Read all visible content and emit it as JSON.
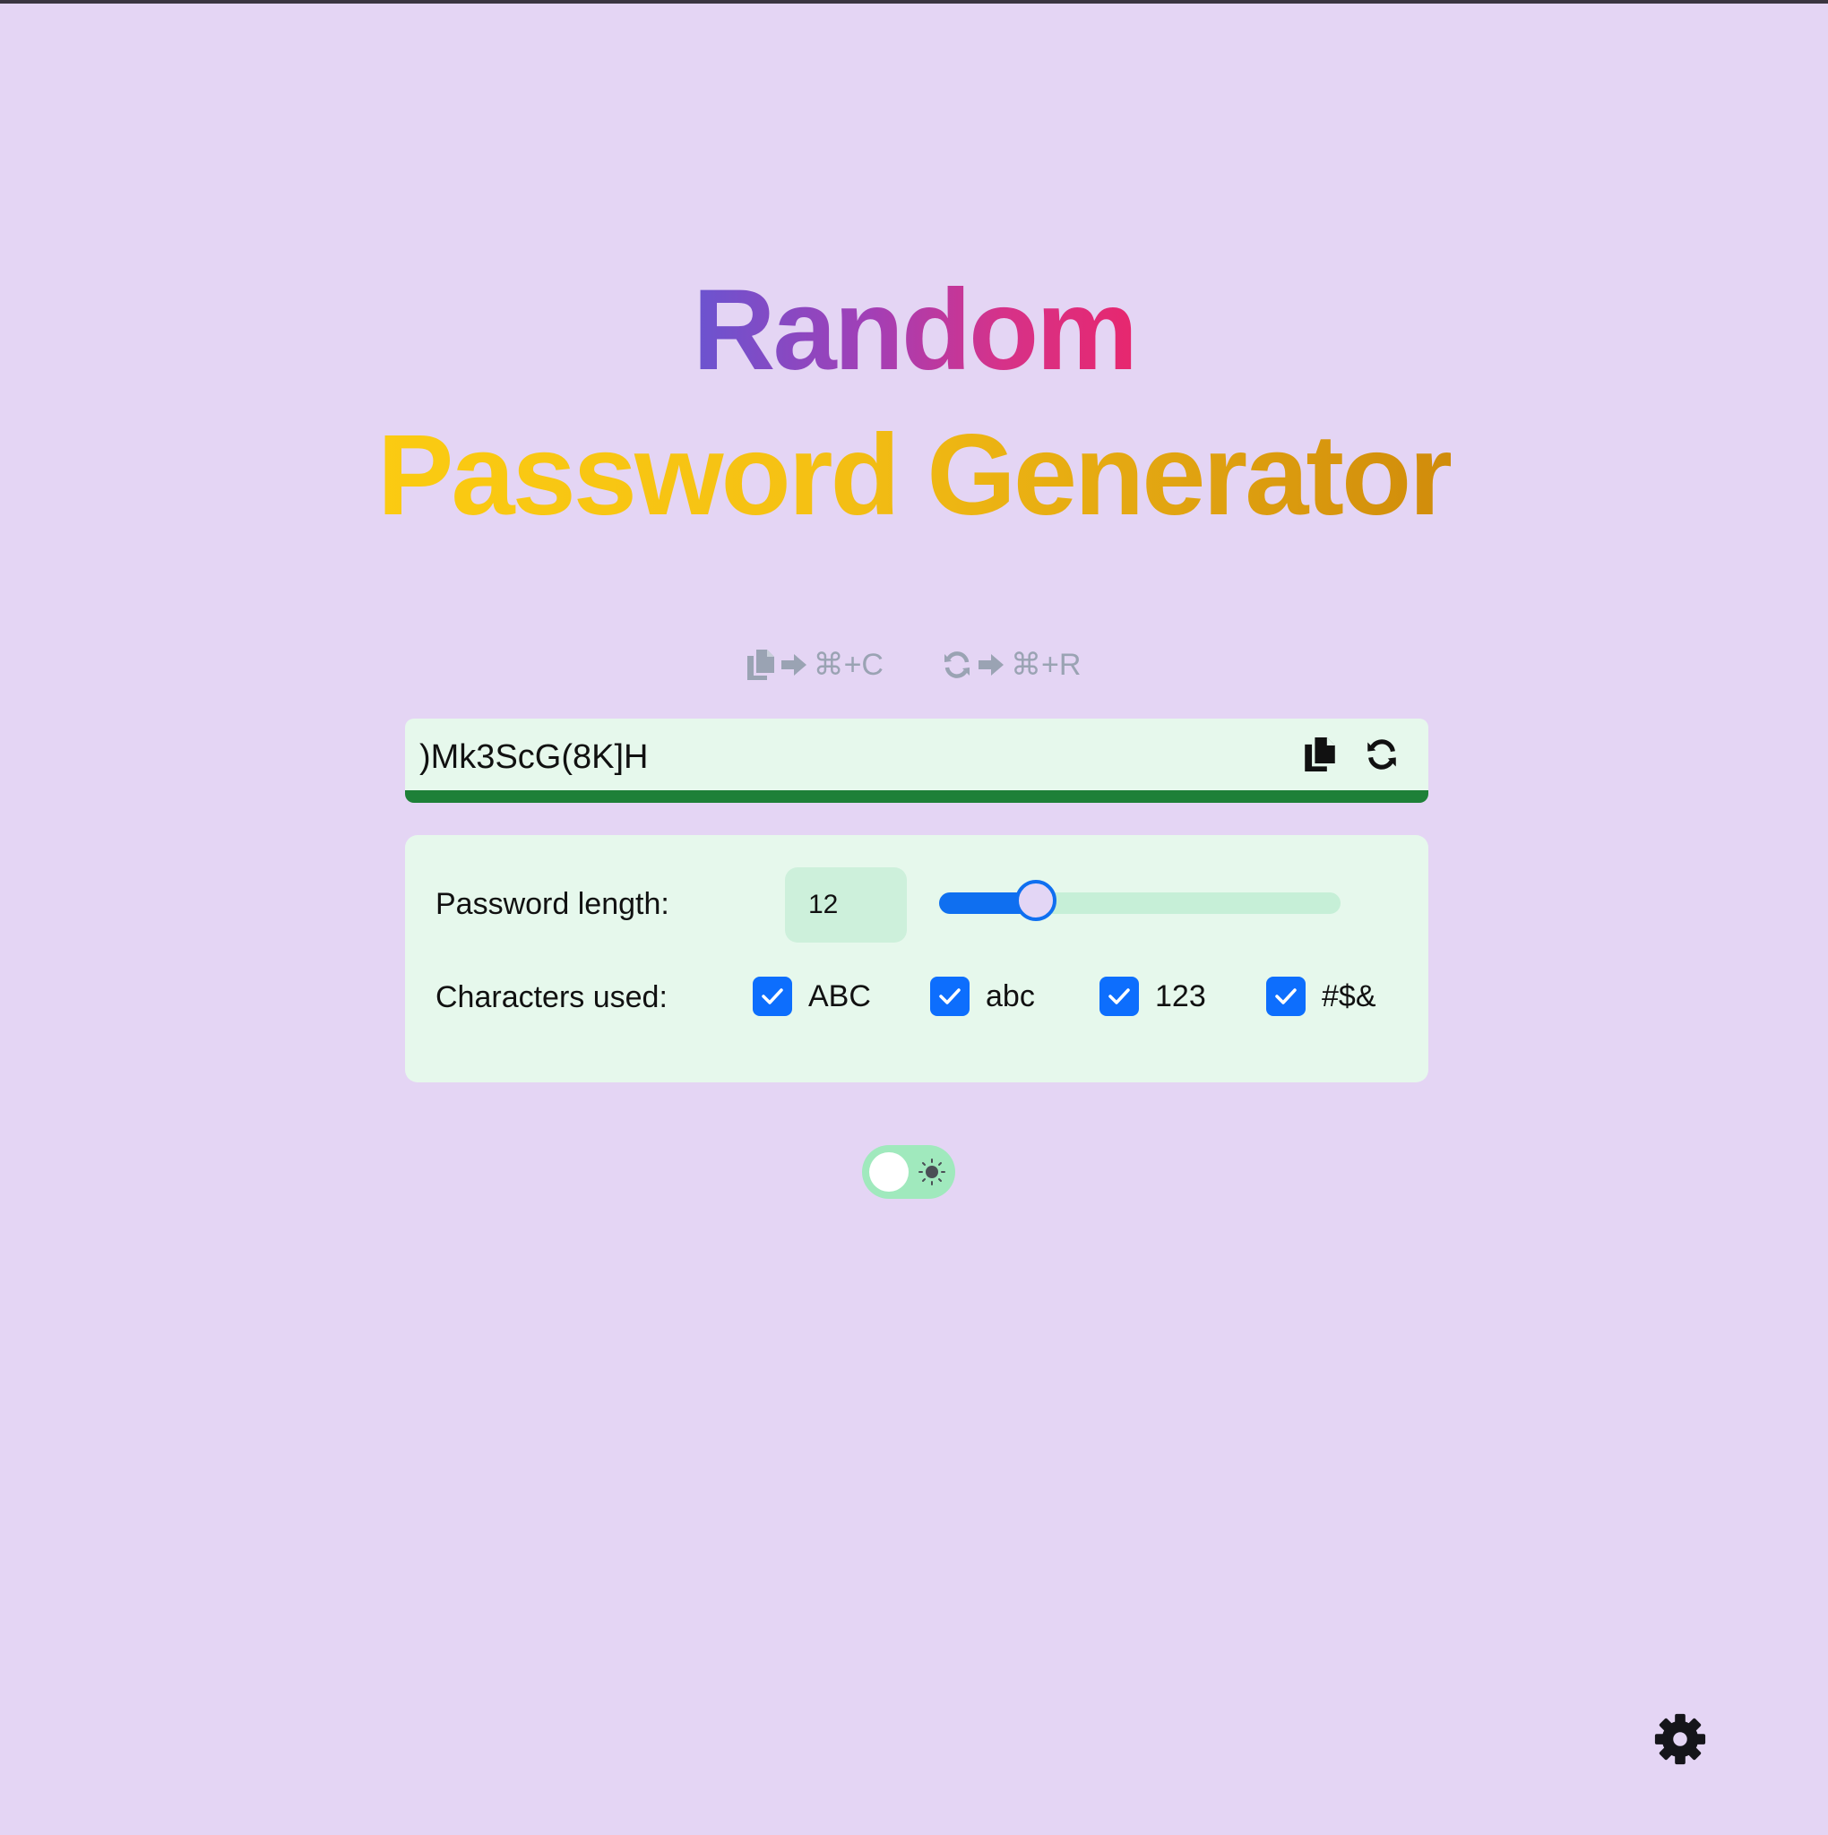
{
  "title": {
    "line1": "Random",
    "line2": "Password Generator"
  },
  "shortcuts": [
    {
      "icon": "copy-icon",
      "arrow": "arrow-right-icon",
      "keys": "⌘+C"
    },
    {
      "icon": "refresh-icon",
      "arrow": "arrow-right-icon",
      "keys": "⌘+R"
    }
  ],
  "password": {
    "value": ")Mk3ScG(8K]H",
    "strength_color": "#1e8038",
    "copy_icon": "copy-icon",
    "refresh_icon": "refresh-icon"
  },
  "options": {
    "length_label": "Password length:",
    "length_value": "12",
    "length_slider_fraction": 0.24,
    "chars_label": "Characters used:",
    "charsets": [
      {
        "label": "ABC",
        "checked": true
      },
      {
        "label": "abc",
        "checked": true
      },
      {
        "label": "123",
        "checked": true
      },
      {
        "label": "#$&",
        "checked": true
      }
    ]
  },
  "theme_toggle": {
    "state": "light",
    "icon": "sun-icon"
  },
  "settings": {
    "icon": "gear-icon"
  },
  "colors": {
    "background": "#e4d5f4",
    "card": "#e6f8ec",
    "accent": "#0d6efd",
    "title_gradient_1": [
      "#6a54d0",
      "#e7276e"
    ],
    "title_gradient_2": [
      "#fbcb12",
      "#d08c0b"
    ]
  }
}
